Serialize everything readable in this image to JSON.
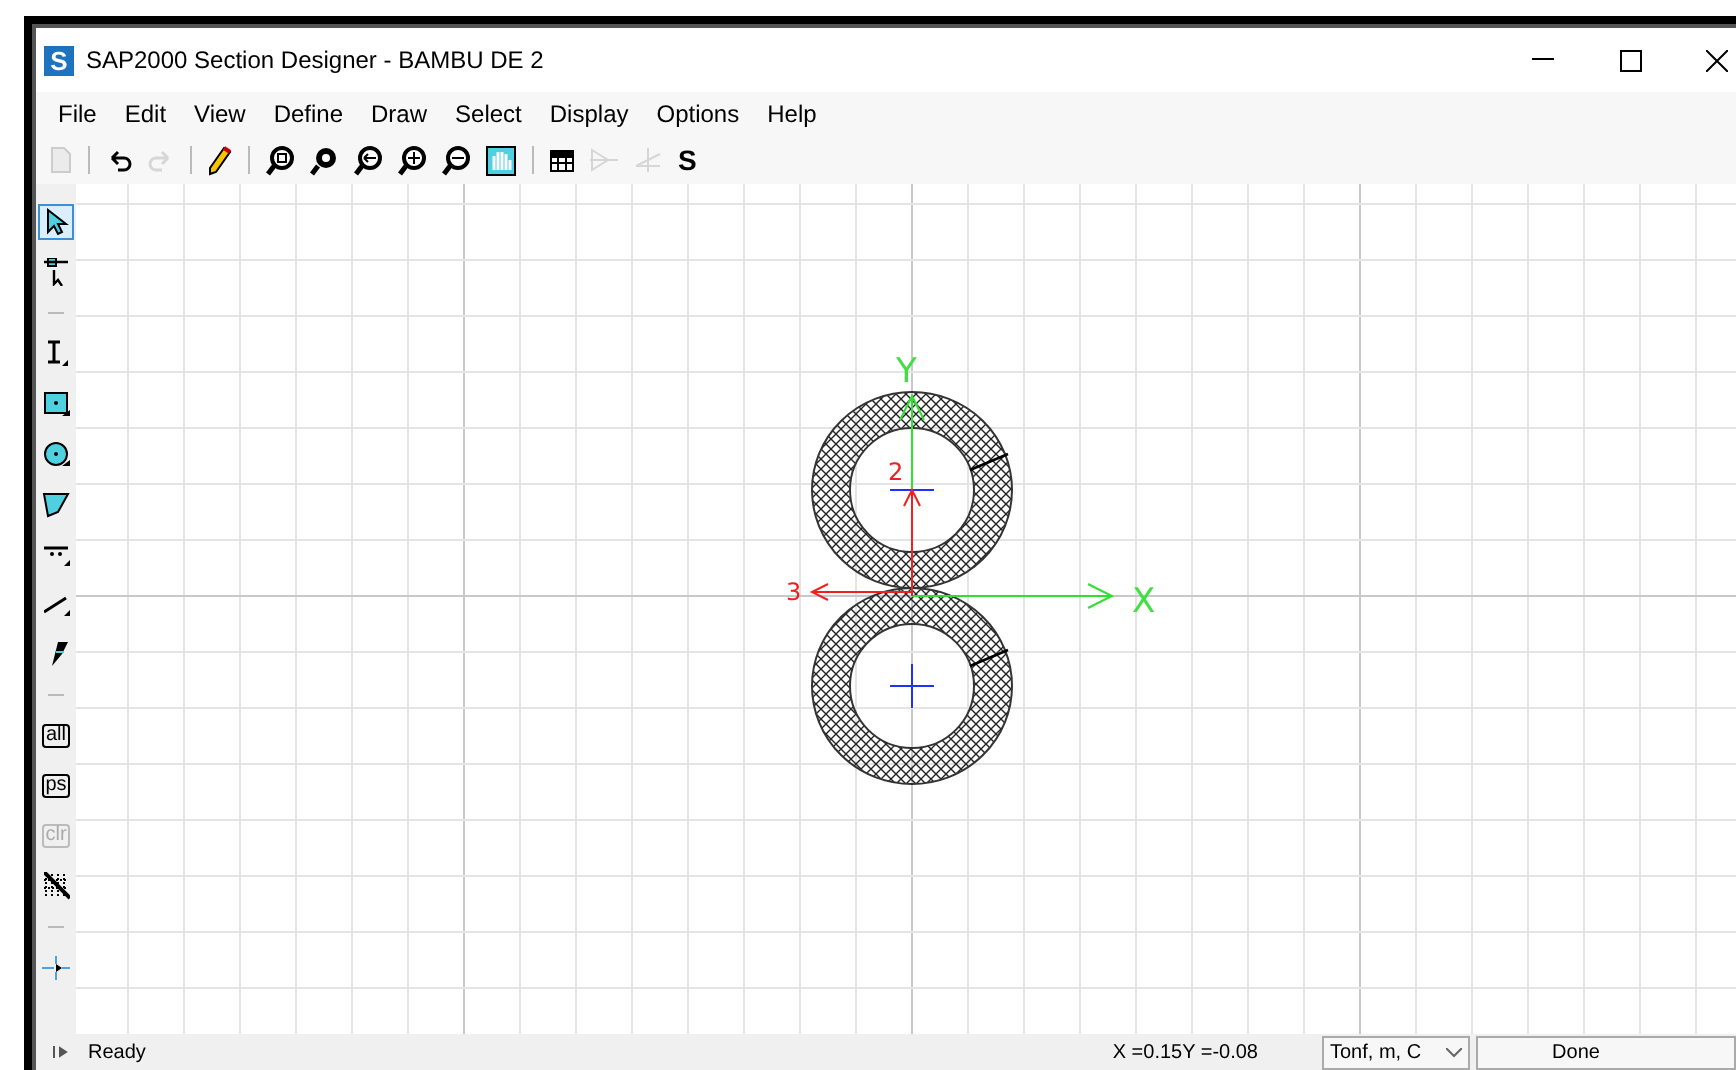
{
  "window": {
    "title": "SAP2000 Section Designer - BAMBU DE 2",
    "logo": "S"
  },
  "menu": [
    {
      "label": "File"
    },
    {
      "label": "Edit"
    },
    {
      "label": "View"
    },
    {
      "label": "Define"
    },
    {
      "label": "Draw"
    },
    {
      "label": "Select"
    },
    {
      "label": "Display"
    },
    {
      "label": "Options"
    },
    {
      "label": "Help"
    }
  ],
  "toolbar": [
    {
      "kind": "new",
      "disabled": true
    },
    {
      "kind": "sep"
    },
    {
      "kind": "undo",
      "disabled": false
    },
    {
      "kind": "redo",
      "disabled": true
    },
    {
      "kind": "sep"
    },
    {
      "kind": "pencil",
      "disabled": false
    },
    {
      "kind": "sep"
    },
    {
      "kind": "zoom-window",
      "disabled": false
    },
    {
      "kind": "zoom-restore",
      "disabled": false
    },
    {
      "kind": "zoom-previous",
      "disabled": false
    },
    {
      "kind": "zoom-in",
      "disabled": false
    },
    {
      "kind": "zoom-out",
      "disabled": false
    },
    {
      "kind": "pan",
      "disabled": false
    },
    {
      "kind": "sep"
    },
    {
      "kind": "table",
      "disabled": false
    },
    {
      "kind": "mirror",
      "disabled": true
    },
    {
      "kind": "angle",
      "disabled": true
    },
    {
      "kind": "label",
      "text": "S",
      "disabled": false
    }
  ],
  "side_toolbar": [
    {
      "kind": "pointer",
      "selected": true,
      "disabled": false
    },
    {
      "kind": "reshape",
      "selected": false,
      "disabled": false
    },
    {
      "kind": "sep"
    },
    {
      "kind": "i-shape",
      "selected": false,
      "disabled": false
    },
    {
      "kind": "rect",
      "selected": false,
      "disabled": false
    },
    {
      "kind": "circle",
      "selected": false,
      "disabled": false
    },
    {
      "kind": "poly",
      "selected": false,
      "disabled": false
    },
    {
      "kind": "rebar-line",
      "selected": false,
      "disabled": false
    },
    {
      "kind": "line",
      "selected": false,
      "disabled": false
    },
    {
      "kind": "rebar",
      "selected": false,
      "disabled": false
    },
    {
      "kind": "sep"
    },
    {
      "kind": "label",
      "text": "all",
      "selected": false,
      "disabled": false
    },
    {
      "kind": "label",
      "text": "ps",
      "selected": false,
      "disabled": false
    },
    {
      "kind": "label",
      "text": "clr",
      "selected": false,
      "disabled": true
    },
    {
      "kind": "hatch",
      "selected": false,
      "disabled": false
    },
    {
      "kind": "sep"
    },
    {
      "kind": "snap",
      "selected": false,
      "disabled": false
    }
  ],
  "drawing": {
    "axis_x": "X",
    "axis_y": "Y",
    "axis_2": "2",
    "axis_3": "3"
  },
  "status_bar": {
    "message": "Ready",
    "coordinates": "X =0.15Y =-0.08",
    "units": "Tonf, m, C",
    "state": "Done"
  }
}
